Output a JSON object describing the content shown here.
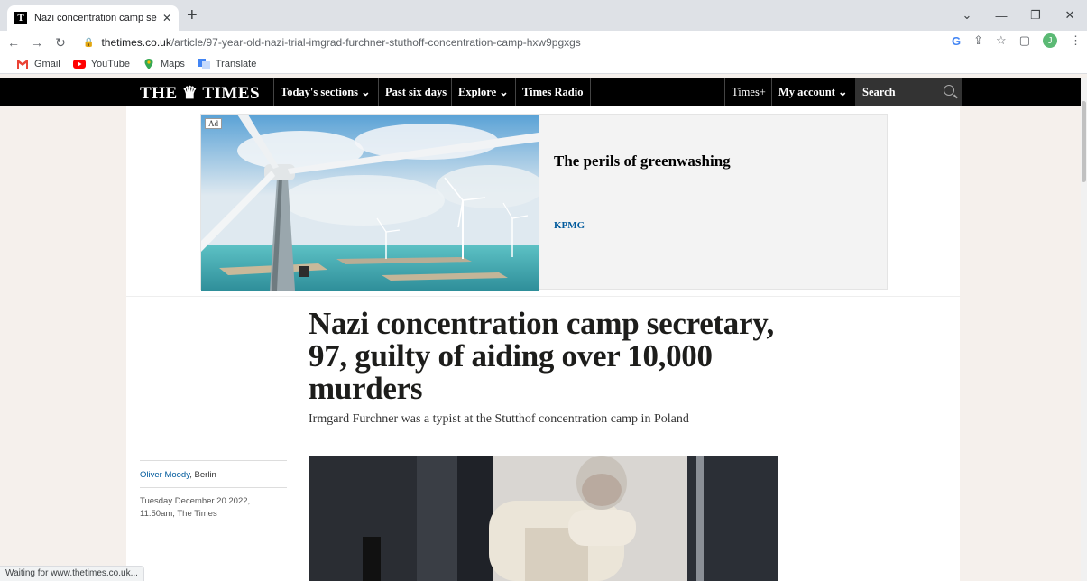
{
  "browser": {
    "tab_title": "Nazi concentration camp secreta",
    "tab_favicon": "T",
    "url_host": "thetimes.co.uk",
    "url_path": "/article/97-year-old-nazi-trial-imgrad-furchner-stuthoff-concentration-camp-hxw9pgxgs",
    "avatar_letter": "J",
    "status": "Waiting for www.thetimes.co.uk...",
    "bookmarks": [
      {
        "label": "Gmail",
        "icon": "gmail-icon"
      },
      {
        "label": "YouTube",
        "icon": "youtube-icon"
      },
      {
        "label": "Maps",
        "icon": "maps-icon"
      },
      {
        "label": "Translate",
        "icon": "translate-icon"
      }
    ]
  },
  "site": {
    "logo": "THE ♛ TIMES",
    "nav": {
      "sections": "Today's sections ⌄",
      "past": "Past six days",
      "explore": "Explore ⌄",
      "radio": "Times Radio",
      "plus": "Times+",
      "account": "My account ⌄",
      "search_placeholder": "Search"
    }
  },
  "ad": {
    "label": "Ad",
    "title": "The perils of greenwashing",
    "brand": "KPMG"
  },
  "article": {
    "headline": "Nazi concentration camp secretary, 97, guilty of aiding over 10,000 murders",
    "standfirst": "Irmgard Furchner was a typist at the Stutthof concentration camp in Poland",
    "author": "Oliver Moody",
    "location": ", Berlin",
    "date": "Tuesday December 20 2022, 11.50am, The Times"
  },
  "colors": {
    "masthead": "#000000",
    "link": "#005a9c",
    "page_bg": "#f5f0ec"
  }
}
